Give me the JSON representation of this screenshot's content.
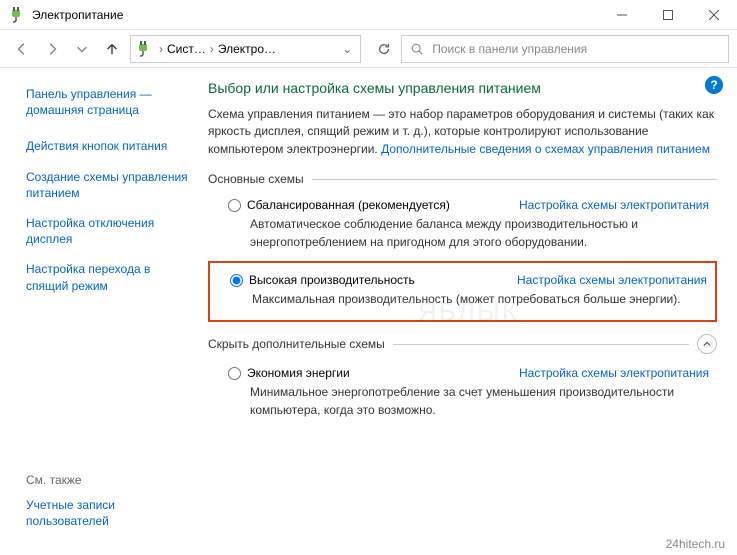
{
  "window": {
    "title": "Электропитание",
    "minimize_aria": "Minimize",
    "maximize_aria": "Maximize",
    "close_aria": "Close"
  },
  "nav": {
    "crumb1": "Сист…",
    "crumb2": "Электро…",
    "refresh_aria": "Refresh"
  },
  "search": {
    "placeholder": "Поиск в панели управления"
  },
  "sidebar": {
    "home": "Панель управления — домашняя страница",
    "items": [
      "Действия кнопок питания",
      "Создание схемы управления питанием",
      "Настройка отключения дисплея",
      "Настройка перехода в спящий режим"
    ],
    "see_also_label": "См. также",
    "see_also_link": "Учетные записи пользователей"
  },
  "main": {
    "help_symbol": "?",
    "heading": "Выбор или настройка схемы управления питанием",
    "intro_plain": "Схема управления питанием — это набор параметров оборудования и системы (таких как яркость дисплея, спящий режим и т. д.), которые контролируют использование компьютером электроэнергии. ",
    "intro_link": "Дополнительные сведения о схемах управления питанием",
    "group_main_label": "Основные схемы",
    "group_extra_label": "Скрыть дополнительные схемы",
    "settings_link": "Настройка схемы электропитания",
    "schemes": [
      {
        "name": "Сбалансированная (рекомендуется)",
        "desc": "Автоматическое соблюдение баланса между производительностью и энергопотреблением на пригодном для этого оборудовании.",
        "selected": false
      },
      {
        "name": "Высокая производительность",
        "desc": "Максимальная производительность (может потребоваться больше энергии).",
        "selected": true
      },
      {
        "name": "Экономия энергии",
        "desc": "Минимальное энергопотребление за счет уменьшения производительности компьютера, когда это возможно.",
        "selected": false
      }
    ]
  },
  "watermark": "ЯБЛЫК",
  "site_caption": "24hitech.ru"
}
